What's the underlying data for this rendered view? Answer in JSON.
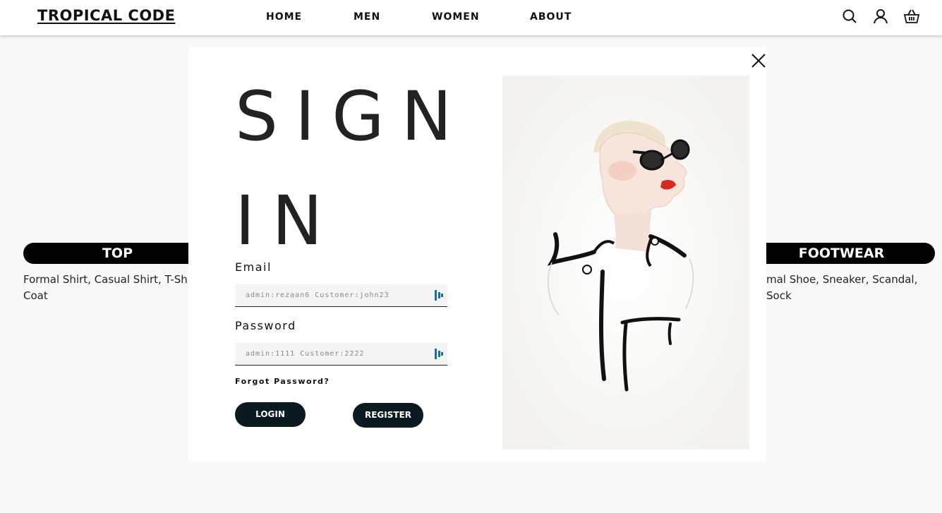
{
  "header": {
    "logo": "TROPICAL CODE",
    "nav": [
      "HOME",
      "MEN",
      "WOMEN",
      "ABOUT"
    ]
  },
  "categories": {
    "left": {
      "title": "TOP",
      "desc_line1": "Formal Shirt, Casual Shirt, T-Shirt",
      "desc_line2": "Coat"
    },
    "right": {
      "title": "FOOTWEAR",
      "desc_line1": "mal Shoe, Sneaker, Scandal, Sock"
    }
  },
  "signin": {
    "title": "SIGN IN",
    "email_label": "Email",
    "email_placeholder": "admin:rezaan6 Customer:john23",
    "password_label": "Password",
    "password_placeholder": "admin:1111 Customer:2222",
    "forgot": "Forgot Password?",
    "login": "LOGIN",
    "register": "REGISTER"
  },
  "colors": {
    "button_bg": "#0b1920",
    "pill_bg": "#000000",
    "password_icon": "#1e6fa0"
  }
}
